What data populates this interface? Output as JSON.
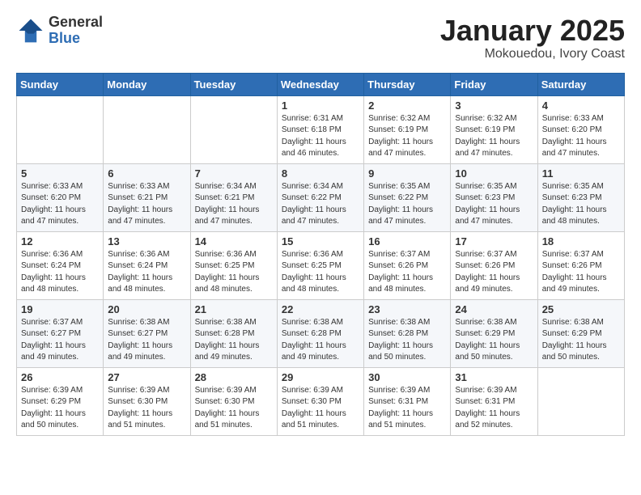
{
  "header": {
    "logo_line1": "General",
    "logo_line2": "Blue",
    "month_title": "January 2025",
    "subtitle": "Mokouedou, Ivory Coast"
  },
  "weekdays": [
    "Sunday",
    "Monday",
    "Tuesday",
    "Wednesday",
    "Thursday",
    "Friday",
    "Saturday"
  ],
  "weeks": [
    [
      {
        "day": "",
        "info": ""
      },
      {
        "day": "",
        "info": ""
      },
      {
        "day": "",
        "info": ""
      },
      {
        "day": "1",
        "info": "Sunrise: 6:31 AM\nSunset: 6:18 PM\nDaylight: 11 hours\nand 46 minutes."
      },
      {
        "day": "2",
        "info": "Sunrise: 6:32 AM\nSunset: 6:19 PM\nDaylight: 11 hours\nand 47 minutes."
      },
      {
        "day": "3",
        "info": "Sunrise: 6:32 AM\nSunset: 6:19 PM\nDaylight: 11 hours\nand 47 minutes."
      },
      {
        "day": "4",
        "info": "Sunrise: 6:33 AM\nSunset: 6:20 PM\nDaylight: 11 hours\nand 47 minutes."
      }
    ],
    [
      {
        "day": "5",
        "info": "Sunrise: 6:33 AM\nSunset: 6:20 PM\nDaylight: 11 hours\nand 47 minutes."
      },
      {
        "day": "6",
        "info": "Sunrise: 6:33 AM\nSunset: 6:21 PM\nDaylight: 11 hours\nand 47 minutes."
      },
      {
        "day": "7",
        "info": "Sunrise: 6:34 AM\nSunset: 6:21 PM\nDaylight: 11 hours\nand 47 minutes."
      },
      {
        "day": "8",
        "info": "Sunrise: 6:34 AM\nSunset: 6:22 PM\nDaylight: 11 hours\nand 47 minutes."
      },
      {
        "day": "9",
        "info": "Sunrise: 6:35 AM\nSunset: 6:22 PM\nDaylight: 11 hours\nand 47 minutes."
      },
      {
        "day": "10",
        "info": "Sunrise: 6:35 AM\nSunset: 6:23 PM\nDaylight: 11 hours\nand 47 minutes."
      },
      {
        "day": "11",
        "info": "Sunrise: 6:35 AM\nSunset: 6:23 PM\nDaylight: 11 hours\nand 48 minutes."
      }
    ],
    [
      {
        "day": "12",
        "info": "Sunrise: 6:36 AM\nSunset: 6:24 PM\nDaylight: 11 hours\nand 48 minutes."
      },
      {
        "day": "13",
        "info": "Sunrise: 6:36 AM\nSunset: 6:24 PM\nDaylight: 11 hours\nand 48 minutes."
      },
      {
        "day": "14",
        "info": "Sunrise: 6:36 AM\nSunset: 6:25 PM\nDaylight: 11 hours\nand 48 minutes."
      },
      {
        "day": "15",
        "info": "Sunrise: 6:36 AM\nSunset: 6:25 PM\nDaylight: 11 hours\nand 48 minutes."
      },
      {
        "day": "16",
        "info": "Sunrise: 6:37 AM\nSunset: 6:26 PM\nDaylight: 11 hours\nand 48 minutes."
      },
      {
        "day": "17",
        "info": "Sunrise: 6:37 AM\nSunset: 6:26 PM\nDaylight: 11 hours\nand 49 minutes."
      },
      {
        "day": "18",
        "info": "Sunrise: 6:37 AM\nSunset: 6:26 PM\nDaylight: 11 hours\nand 49 minutes."
      }
    ],
    [
      {
        "day": "19",
        "info": "Sunrise: 6:37 AM\nSunset: 6:27 PM\nDaylight: 11 hours\nand 49 minutes."
      },
      {
        "day": "20",
        "info": "Sunrise: 6:38 AM\nSunset: 6:27 PM\nDaylight: 11 hours\nand 49 minutes."
      },
      {
        "day": "21",
        "info": "Sunrise: 6:38 AM\nSunset: 6:28 PM\nDaylight: 11 hours\nand 49 minutes."
      },
      {
        "day": "22",
        "info": "Sunrise: 6:38 AM\nSunset: 6:28 PM\nDaylight: 11 hours\nand 49 minutes."
      },
      {
        "day": "23",
        "info": "Sunrise: 6:38 AM\nSunset: 6:28 PM\nDaylight: 11 hours\nand 50 minutes."
      },
      {
        "day": "24",
        "info": "Sunrise: 6:38 AM\nSunset: 6:29 PM\nDaylight: 11 hours\nand 50 minutes."
      },
      {
        "day": "25",
        "info": "Sunrise: 6:38 AM\nSunset: 6:29 PM\nDaylight: 11 hours\nand 50 minutes."
      }
    ],
    [
      {
        "day": "26",
        "info": "Sunrise: 6:39 AM\nSunset: 6:29 PM\nDaylight: 11 hours\nand 50 minutes."
      },
      {
        "day": "27",
        "info": "Sunrise: 6:39 AM\nSunset: 6:30 PM\nDaylight: 11 hours\nand 51 minutes."
      },
      {
        "day": "28",
        "info": "Sunrise: 6:39 AM\nSunset: 6:30 PM\nDaylight: 11 hours\nand 51 minutes."
      },
      {
        "day": "29",
        "info": "Sunrise: 6:39 AM\nSunset: 6:30 PM\nDaylight: 11 hours\nand 51 minutes."
      },
      {
        "day": "30",
        "info": "Sunrise: 6:39 AM\nSunset: 6:31 PM\nDaylight: 11 hours\nand 51 minutes."
      },
      {
        "day": "31",
        "info": "Sunrise: 6:39 AM\nSunset: 6:31 PM\nDaylight: 11 hours\nand 52 minutes."
      },
      {
        "day": "",
        "info": ""
      }
    ]
  ]
}
